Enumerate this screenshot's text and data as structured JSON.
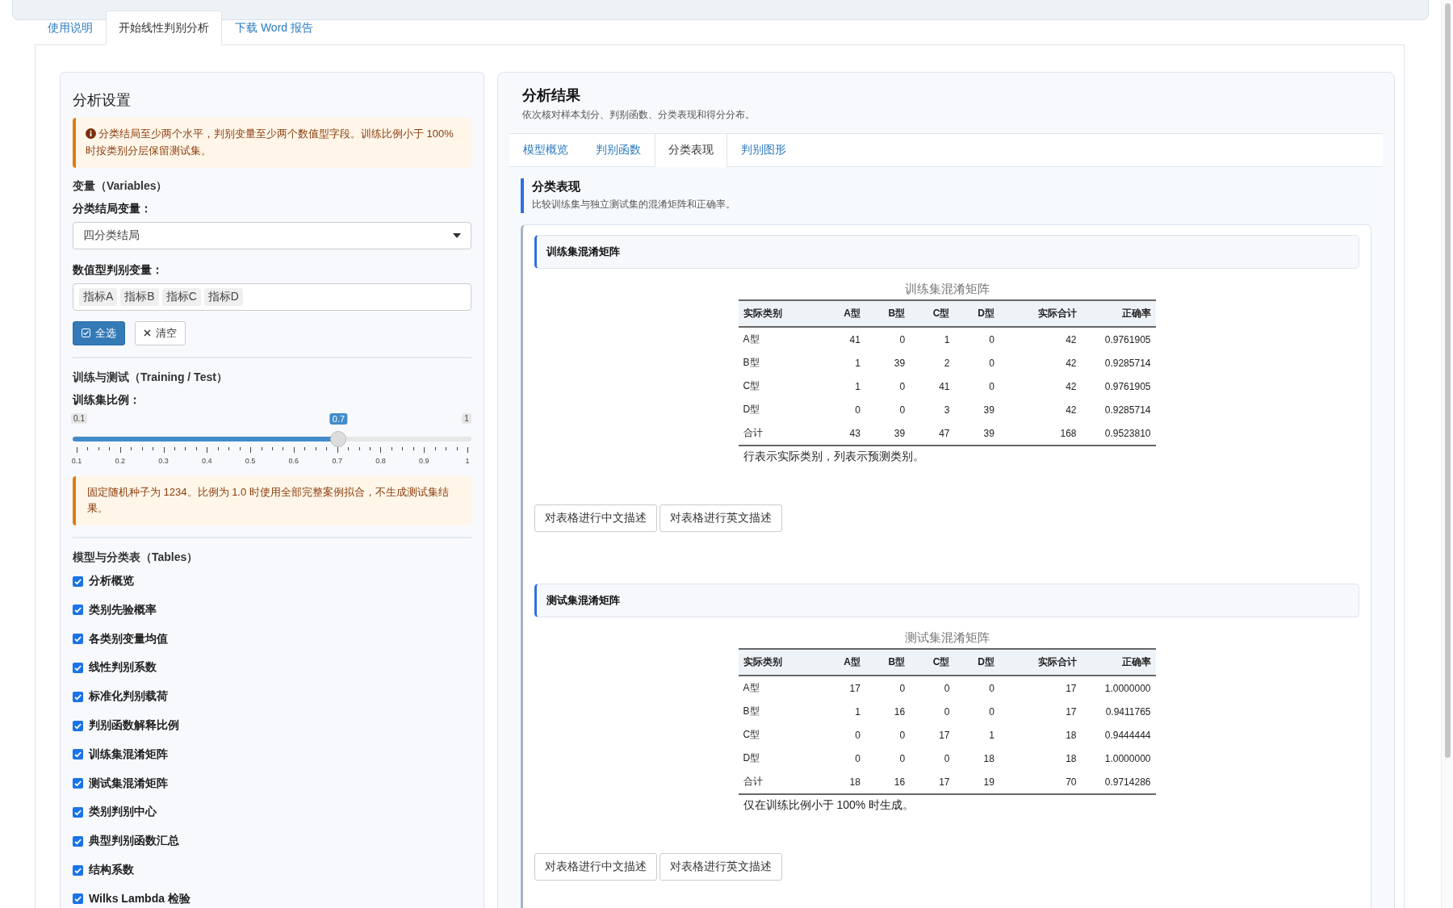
{
  "top_tabs": [
    {
      "label": "使用说明",
      "selected": false
    },
    {
      "label": "开始线性判别分析",
      "selected": true
    },
    {
      "label": "下载 Word 报告",
      "selected": false
    }
  ],
  "settings": {
    "title": "分析设置",
    "alert": "分类结局至少两个水平，判别变量至少两个数值型字段。训练比例小于 100% 时按类别分层保留测试集。",
    "variables_heading": "变量（Variables）",
    "outcome_label": "分类结局变量：",
    "outcome_value": "四分类结局",
    "predictors_label": "数值型判别变量：",
    "predictors": [
      "指标A",
      "指标B",
      "指标C",
      "指标D"
    ],
    "select_all": "全选",
    "clear": "清空",
    "split_heading": "训练与测试（Training / Test）",
    "slider": {
      "label": "训练集比例：",
      "min_label": "0.1",
      "max_label": "1",
      "value_label": "0.7",
      "level": 0.667,
      "ticks": [
        "0.1",
        "0.2",
        "0.3",
        "0.4",
        "0.5",
        "0.6",
        "0.7",
        "0.8",
        "0.9",
        "1"
      ]
    },
    "seed_note": "固定随机种子为 1234。比例为 1.0 时使用全部完整案例拟合，不生成测试集结果。",
    "tables_heading": "模型与分类表（Tables）",
    "options": [
      {
        "label": "分析概览",
        "checked": true
      },
      {
        "label": "类别先验概率",
        "checked": true
      },
      {
        "label": "各类别变量均值",
        "checked": true
      },
      {
        "label": "线性判别系数",
        "checked": true
      },
      {
        "label": "标准化判别载荷",
        "checked": true
      },
      {
        "label": "判别函数解释比例",
        "checked": true
      },
      {
        "label": "训练集混淆矩阵",
        "checked": true
      },
      {
        "label": "测试集混淆矩阵",
        "checked": true
      },
      {
        "label": "类别判别中心",
        "checked": true
      },
      {
        "label": "典型判别函数汇总",
        "checked": true
      },
      {
        "label": "结构系数",
        "checked": true
      },
      {
        "label": "Wilks Lambda 检验",
        "checked": true
      }
    ]
  },
  "results": {
    "title": "分析结果",
    "subtitle": "依次核对样本划分、判别函数、分类表现和得分分布。",
    "tabs": [
      {
        "label": "模型概览",
        "selected": false
      },
      {
        "label": "判别函数",
        "selected": false
      },
      {
        "label": "分类表现",
        "selected": true
      },
      {
        "label": "判别图形",
        "selected": false
      }
    ],
    "section_title": "分类表现",
    "section_subtitle": "比较训练集与独立测试集的混淆矩阵和正确率。",
    "cards": [
      {
        "header": "训练集混淆矩阵",
        "caption": "训练集混淆矩阵",
        "columns": [
          "实际类别",
          "A型",
          "B型",
          "C型",
          "D型",
          "实际合计",
          "正确率"
        ],
        "rows": [
          [
            "A型",
            "41",
            "0",
            "1",
            "0",
            "42",
            "0.9761905"
          ],
          [
            "B型",
            "1",
            "39",
            "2",
            "0",
            "42",
            "0.9285714"
          ],
          [
            "C型",
            "1",
            "0",
            "41",
            "0",
            "42",
            "0.9761905"
          ],
          [
            "D型",
            "0",
            "0",
            "3",
            "39",
            "42",
            "0.9285714"
          ],
          [
            "合计",
            "43",
            "39",
            "47",
            "39",
            "168",
            "0.9523810"
          ]
        ],
        "note": "行表示实际类别，列表示预测类别。",
        "buttons": [
          "对表格进行中文描述",
          "对表格进行英文描述"
        ]
      },
      {
        "header": "测试集混淆矩阵",
        "caption": "测试集混淆矩阵",
        "columns": [
          "实际类别",
          "A型",
          "B型",
          "C型",
          "D型",
          "实际合计",
          "正确率"
        ],
        "rows": [
          [
            "A型",
            "17",
            "0",
            "0",
            "0",
            "17",
            "1.0000000"
          ],
          [
            "B型",
            "1",
            "16",
            "0",
            "0",
            "17",
            "0.9411765"
          ],
          [
            "C型",
            "0",
            "0",
            "17",
            "1",
            "18",
            "0.9444444"
          ],
          [
            "D型",
            "0",
            "0",
            "0",
            "18",
            "18",
            "1.0000000"
          ],
          [
            "合计",
            "18",
            "16",
            "17",
            "19",
            "70",
            "0.9714286"
          ]
        ],
        "note": "仅在训练比例小于 100% 时生成。",
        "buttons": [
          "对表格进行中文描述",
          "对表格进行英文描述"
        ]
      }
    ]
  }
}
